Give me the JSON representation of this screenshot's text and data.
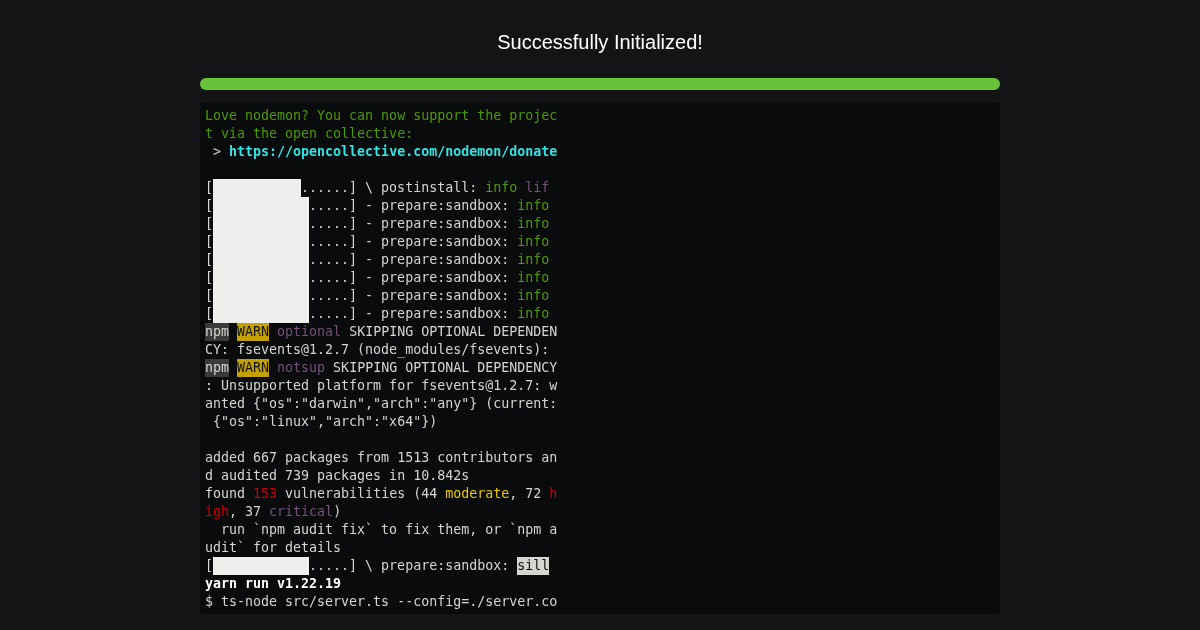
{
  "title": "Successfully Initialized!",
  "progress": {
    "level": 1
  },
  "terminal": {
    "lines": [
      {
        "kind": "text",
        "segments": [
          {
            "kind": "green",
            "text": "Love nodemon? You can now support the projec"
          }
        ]
      },
      {
        "kind": "text",
        "segments": [
          {
            "kind": "green",
            "text": "t via the open collective:"
          }
        ]
      },
      {
        "kind": "text",
        "segments": [
          {
            "kind": "plain",
            "text": " >"
          },
          {
            "kind": "link",
            "text": " https://opencollective.com/nodemon/donate"
          }
        ]
      },
      {
        "kind": "blank"
      },
      {
        "kind": "text",
        "segments": [
          {
            "kind": "plain",
            "text": "["
          },
          {
            "kind": "bar"
          },
          {
            "kind": "plain",
            "text": "......] \\ postinstall:"
          },
          {
            "kind": "green",
            "text": " info"
          },
          {
            "kind": "purple",
            "text": " lif"
          }
        ]
      },
      {
        "kind": "text",
        "segments": [
          {
            "kind": "plain",
            "text": "["
          },
          {
            "kind": "bar"
          },
          {
            "kind": "plain",
            "text": ".....] - prepare:sandbox:"
          },
          {
            "kind": "green",
            "text": " info"
          }
        ]
      },
      {
        "kind": "text",
        "segments": [
          {
            "kind": "plain",
            "text": "["
          },
          {
            "kind": "bar"
          },
          {
            "kind": "plain",
            "text": ".....] - prepare:sandbox:"
          },
          {
            "kind": "green",
            "text": " info"
          }
        ]
      },
      {
        "kind": "text",
        "segments": [
          {
            "kind": "plain",
            "text": "["
          },
          {
            "kind": "bar"
          },
          {
            "kind": "plain",
            "text": ".....] - prepare:sandbox:"
          },
          {
            "kind": "green",
            "text": " info"
          }
        ]
      },
      {
        "kind": "text",
        "segments": [
          {
            "kind": "plain",
            "text": "["
          },
          {
            "kind": "bar"
          },
          {
            "kind": "plain",
            "text": ".....] - prepare:sandbox:"
          },
          {
            "kind": "green",
            "text": " info"
          }
        ]
      },
      {
        "kind": "text",
        "segments": [
          {
            "kind": "plain",
            "text": "["
          },
          {
            "kind": "bar"
          },
          {
            "kind": "plain",
            "text": ".....] - prepare:sandbox:"
          },
          {
            "kind": "green",
            "text": " info"
          }
        ]
      },
      {
        "kind": "text",
        "segments": [
          {
            "kind": "plain",
            "text": "["
          },
          {
            "kind": "bar"
          },
          {
            "kind": "plain",
            "text": ".....] - prepare:sandbox:"
          },
          {
            "kind": "green",
            "text": " info"
          }
        ]
      },
      {
        "kind": "text",
        "segments": [
          {
            "kind": "plain",
            "text": "["
          },
          {
            "kind": "bar"
          },
          {
            "kind": "plain",
            "text": ".....] - prepare:sandbox:"
          },
          {
            "kind": "green",
            "text": " info"
          }
        ]
      },
      {
        "kind": "text",
        "segments": [
          {
            "kind": "tag",
            "text": "npm"
          },
          {
            "kind": "warn",
            "text": "WARN"
          },
          {
            "kind": "purple",
            "text": " optional"
          },
          {
            "kind": "plain",
            "text": " SKIPPING OPTIONAL DEPENDEN"
          }
        ]
      },
      {
        "kind": "text",
        "segments": [
          {
            "kind": "plain",
            "text": "CY: fsevents@1.2.7 (node_modules/fsevents):"
          }
        ]
      },
      {
        "kind": "text",
        "segments": [
          {
            "kind": "tag",
            "text": "npm"
          },
          {
            "kind": "warn",
            "text": "WARN"
          },
          {
            "kind": "purple",
            "text": " notsup"
          },
          {
            "kind": "plain",
            "text": " SKIPPING OPTIONAL DEPENDENCY"
          }
        ]
      },
      {
        "kind": "text",
        "segments": [
          {
            "kind": "plain",
            "text": ": Unsupported platform for fsevents@1.2.7: w"
          }
        ]
      },
      {
        "kind": "text",
        "segments": [
          {
            "kind": "plain",
            "text": "anted {\"os\":\"darwin\",\"arch\":\"any\"} (current:"
          }
        ]
      },
      {
        "kind": "text",
        "segments": [
          {
            "kind": "plain",
            "text": " {\"os\":\"linux\",\"arch\":\"x64\"})"
          }
        ]
      },
      {
        "kind": "blank"
      },
      {
        "kind": "text",
        "segments": [
          {
            "kind": "plain",
            "text": "added 667 packages from 1513 contributors an"
          }
        ]
      },
      {
        "kind": "text",
        "segments": [
          {
            "kind": "plain",
            "text": "d audited 739 packages in 10.842s"
          }
        ]
      },
      {
        "kind": "text",
        "segments": [
          {
            "kind": "plain",
            "text": "found"
          },
          {
            "kind": "red",
            "text": " 153"
          },
          {
            "kind": "plain",
            "text": " vulnerabilities (44"
          },
          {
            "kind": "yellow",
            "text": " moderate"
          },
          {
            "kind": "plain",
            "text": ", 72"
          },
          {
            "kind": "red",
            "text": " h"
          }
        ]
      },
      {
        "kind": "text",
        "segments": [
          {
            "kind": "red",
            "text": "igh"
          },
          {
            "kind": "plain",
            "text": ", 37"
          },
          {
            "kind": "purple",
            "text": " critical"
          },
          {
            "kind": "plain",
            "text": ")"
          }
        ]
      },
      {
        "kind": "text",
        "segments": [
          {
            "kind": "plain",
            "text": "  run `npm audit fix` to fix them, or `npm a"
          }
        ]
      },
      {
        "kind": "text",
        "segments": [
          {
            "kind": "plain",
            "text": "udit` for details"
          }
        ]
      },
      {
        "kind": "text",
        "segments": [
          {
            "kind": "plain",
            "text": "["
          },
          {
            "kind": "bar"
          },
          {
            "kind": "plain",
            "text": ".....] \\ prepare:sandbox:"
          },
          {
            "kind": "highlight",
            "text": "sill"
          }
        ]
      },
      {
        "kind": "text",
        "segments": [
          {
            "kind": "bold",
            "text": "yarn run v1.22.19"
          }
        ]
      },
      {
        "kind": "text",
        "segments": [
          {
            "kind": "plain",
            "text": "$ ts-node src/server.ts --config=./server.co"
          }
        ]
      }
    ]
  }
}
